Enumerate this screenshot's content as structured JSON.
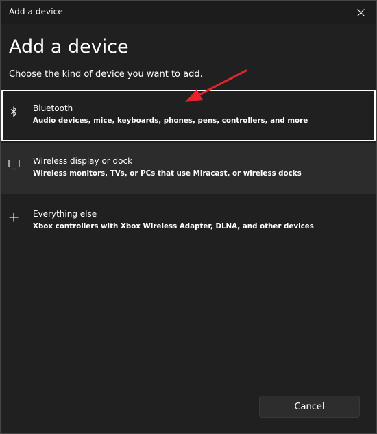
{
  "window": {
    "title": "Add a device"
  },
  "heading": "Add a device",
  "subheading": "Choose the kind of device you want to add.",
  "options": [
    {
      "title": "Bluetooth",
      "description": "Audio devices, mice, keyboards, phones, pens, controllers, and more",
      "icon": "bluetooth-icon",
      "state": "selected"
    },
    {
      "title": "Wireless display or dock",
      "description": "Wireless monitors, TVs, or PCs that use Miracast, or wireless docks",
      "icon": "monitor-icon",
      "state": "hover"
    },
    {
      "title": "Everything else",
      "description": "Xbox controllers with Xbox Wireless Adapter, DLNA, and other devices",
      "icon": "plus-icon",
      "state": "normal"
    }
  ],
  "footer": {
    "cancel_label": "Cancel"
  },
  "annotation": {
    "icon": "red-arrow-icon",
    "color": "#e0262b"
  },
  "colors": {
    "background": "#202020",
    "titlebar": "#1c1c1c",
    "hover_row": "#2c2c2c",
    "selection_border": "#ffffff",
    "button": "#2d2d2d"
  }
}
